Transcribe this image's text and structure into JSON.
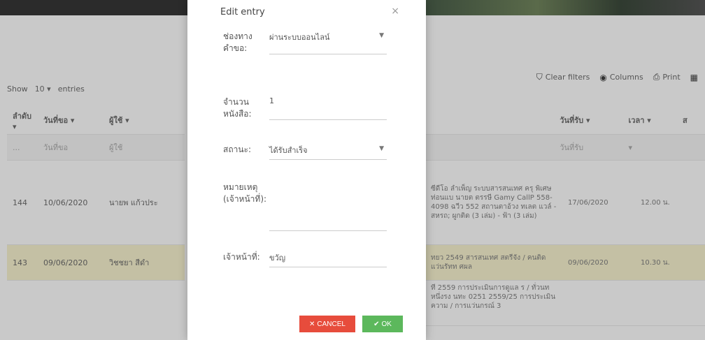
{
  "modal": {
    "title": "Edit entry",
    "fields": [
      {
        "label": "ช่องทางคำขอ:",
        "value": "ผ่านระบบออนไลน์",
        "type": "select"
      },
      {
        "label": "จำนวนหนังสือ:",
        "value": "1",
        "type": "input"
      },
      {
        "label": "สถานะ:",
        "value": "ได้รับสำเร็จ",
        "type": "select"
      },
      {
        "label": "หมายเหตุ (เจ้าหน้าที่):",
        "value": "",
        "type": "textarea"
      },
      {
        "label": "เจ้าหน้าที่:",
        "value": "ขวัญ",
        "type": "input"
      }
    ],
    "cancel_label": "CANCEL",
    "ok_label": "OK"
  },
  "toolbar": {
    "clear_filters": "Clear filters",
    "columns": "Columns",
    "print": "Print"
  },
  "show_entries": {
    "prefix": "Show",
    "value": "10",
    "suffix": "entries"
  },
  "table": {
    "headers": [
      "ลำดับ",
      "วันที่ขอ",
      "ผู้ใช้"
    ],
    "filters": [
      "...",
      "วันที่ขอ",
      "ผู้ใช้"
    ],
    "rows": [
      {
        "no": "144",
        "date": "10/06/2020",
        "user": "นายพ แก้วประ"
      },
      {
        "no": "143",
        "date": "09/06/2020",
        "user": "วิชชยา สีดำ"
      }
    ]
  },
  "right_table": {
    "headers": [
      "",
      "วันที่รับ",
      "เวลา",
      "ส"
    ],
    "filters": [
      "",
      "วันที่รับ",
      "",
      ""
    ],
    "rows": [
      {
        "desc": "ซีดีโอ ลำเพ็ญ ระบบสารสนเทศ ครุ พิเศษท่อนแบ นายต ตรรษี Gamy CallP 558-4098 ฉวีว 552 สถานตาอ้วง ทเลต แวล์ - สหรถ; ผูกติด (3 เล่ม) - ฟ้า (3 เล่ม)",
        "date": "17/06/2020",
        "time": "12.00 น."
      },
      {
        "desc": "ทยว 2549 สารสนเทศ สตรีจัง / คนติด แว่นรัทท ศผล",
        "date": "09/06/2020",
        "time": "10.30 น."
      },
      {
        "desc": "ที 2559 การประเมินการดูแล ร / ทั่วนท หนึ่งรง นทะ 0251 2559/25 การประเมิน ความ / การแว่นกรณ์ 3",
        "date": "",
        "time": ""
      }
    ]
  }
}
